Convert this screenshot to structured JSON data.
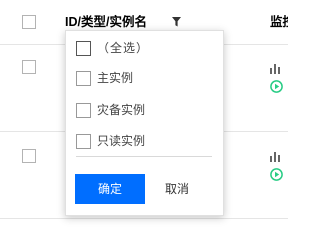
{
  "table": {
    "header": {
      "title": "ID/类型/实例名",
      "filter_icon": "filter-icon",
      "monitor_col": "监控"
    },
    "rows": [
      {
        "icons": [
          "bar-chart-icon",
          "play-circle-icon"
        ]
      },
      {
        "icons": [
          "bar-chart-icon",
          "play-circle-icon"
        ]
      }
    ]
  },
  "filter_popup": {
    "options": [
      {
        "label": "（全选）",
        "checked": false
      },
      {
        "label": "主实例",
        "checked": false
      },
      {
        "label": "灾备实例",
        "checked": false
      },
      {
        "label": "只读实例",
        "checked": false
      }
    ],
    "confirm_label": "确定",
    "cancel_label": "取消"
  },
  "colors": {
    "primary": "#006eff",
    "success": "#29cc85",
    "border": "#e5e5e5",
    "icon_gray": "#666666"
  }
}
